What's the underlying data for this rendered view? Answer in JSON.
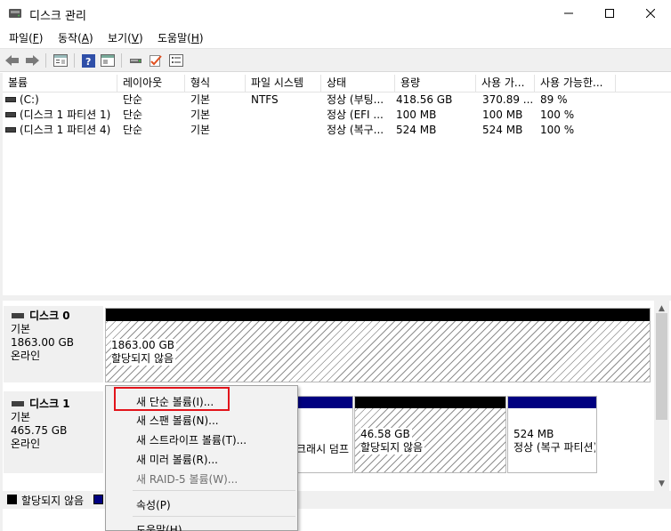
{
  "window": {
    "title": "디스크 관리",
    "minimize": "—",
    "maximize": "☐",
    "close": "✕"
  },
  "menu": [
    {
      "label": "파일",
      "key": "F"
    },
    {
      "label": "동작",
      "key": "A"
    },
    {
      "label": "보기",
      "key": "V"
    },
    {
      "label": "도움말",
      "key": "H"
    }
  ],
  "toolbar_icons": [
    "back-icon",
    "forward-icon",
    "properties-icon",
    "help-icon",
    "console-icon",
    "connect-icon",
    "check-icon",
    "list-icon"
  ],
  "columns": [
    "볼륨",
    "레이아웃",
    "형식",
    "파일 시스템",
    "상태",
    "용량",
    "사용 가...",
    "사용 가능한..."
  ],
  "volumes": [
    {
      "name": "(C:)",
      "layout": "단순",
      "type": "기본",
      "fs": "NTFS",
      "status": "정상 (부팅...",
      "capacity": "418.56 GB",
      "free": "370.89 ...",
      "pct": "89 %"
    },
    {
      "name": "(디스크 1 파티션 1)",
      "layout": "단순",
      "type": "기본",
      "fs": "",
      "status": "정상 (EFI ...",
      "capacity": "100 MB",
      "free": "100 MB",
      "pct": "100 %"
    },
    {
      "name": "(디스크 1 파티션 4)",
      "layout": "단순",
      "type": "기본",
      "fs": "",
      "status": "정상 (복구...",
      "capacity": "524 MB",
      "free": "524 MB",
      "pct": "100 %"
    }
  ],
  "disks": [
    {
      "name": "디스크 0",
      "type": "기본",
      "size": "1863.00 GB",
      "state": "온라인"
    },
    {
      "name": "디스크 1",
      "type": "기본",
      "size": "465.75 GB",
      "state": "온라인"
    }
  ],
  "partitions": {
    "disk0_p1": {
      "size": "1863.00 GB",
      "state": "할당되지 않음"
    },
    "disk1_p3": {
      "state": "크래시 덤프"
    },
    "disk1_p4": {
      "size": "46.58 GB",
      "state": "할당되지 않음"
    },
    "disk1_p5": {
      "size": "524 MB",
      "state": "정상 (복구 파티션)"
    }
  },
  "legend": [
    {
      "label": "할당되지 않음",
      "color": "#000000"
    },
    {
      "label": "",
      "color": "#000080"
    }
  ],
  "context_menu": [
    {
      "label": "새 단순 볼륨(I)...",
      "enabled": true
    },
    {
      "label": "새 스팬 볼륨(N)...",
      "enabled": true
    },
    {
      "label": "새 스트라이프 볼륨(T)...",
      "enabled": true
    },
    {
      "label": "새 미러 볼륨(R)...",
      "enabled": true
    },
    {
      "label": "새 RAID-5 볼륨(W)...",
      "enabled": false
    },
    {
      "label": "속성(P)",
      "enabled": true
    },
    {
      "label": "도움말(H)",
      "enabled": true
    }
  ],
  "colors": {
    "unallocated_bar": "#000000",
    "primary_bar": "#000080",
    "highlight": "#e2141b"
  }
}
